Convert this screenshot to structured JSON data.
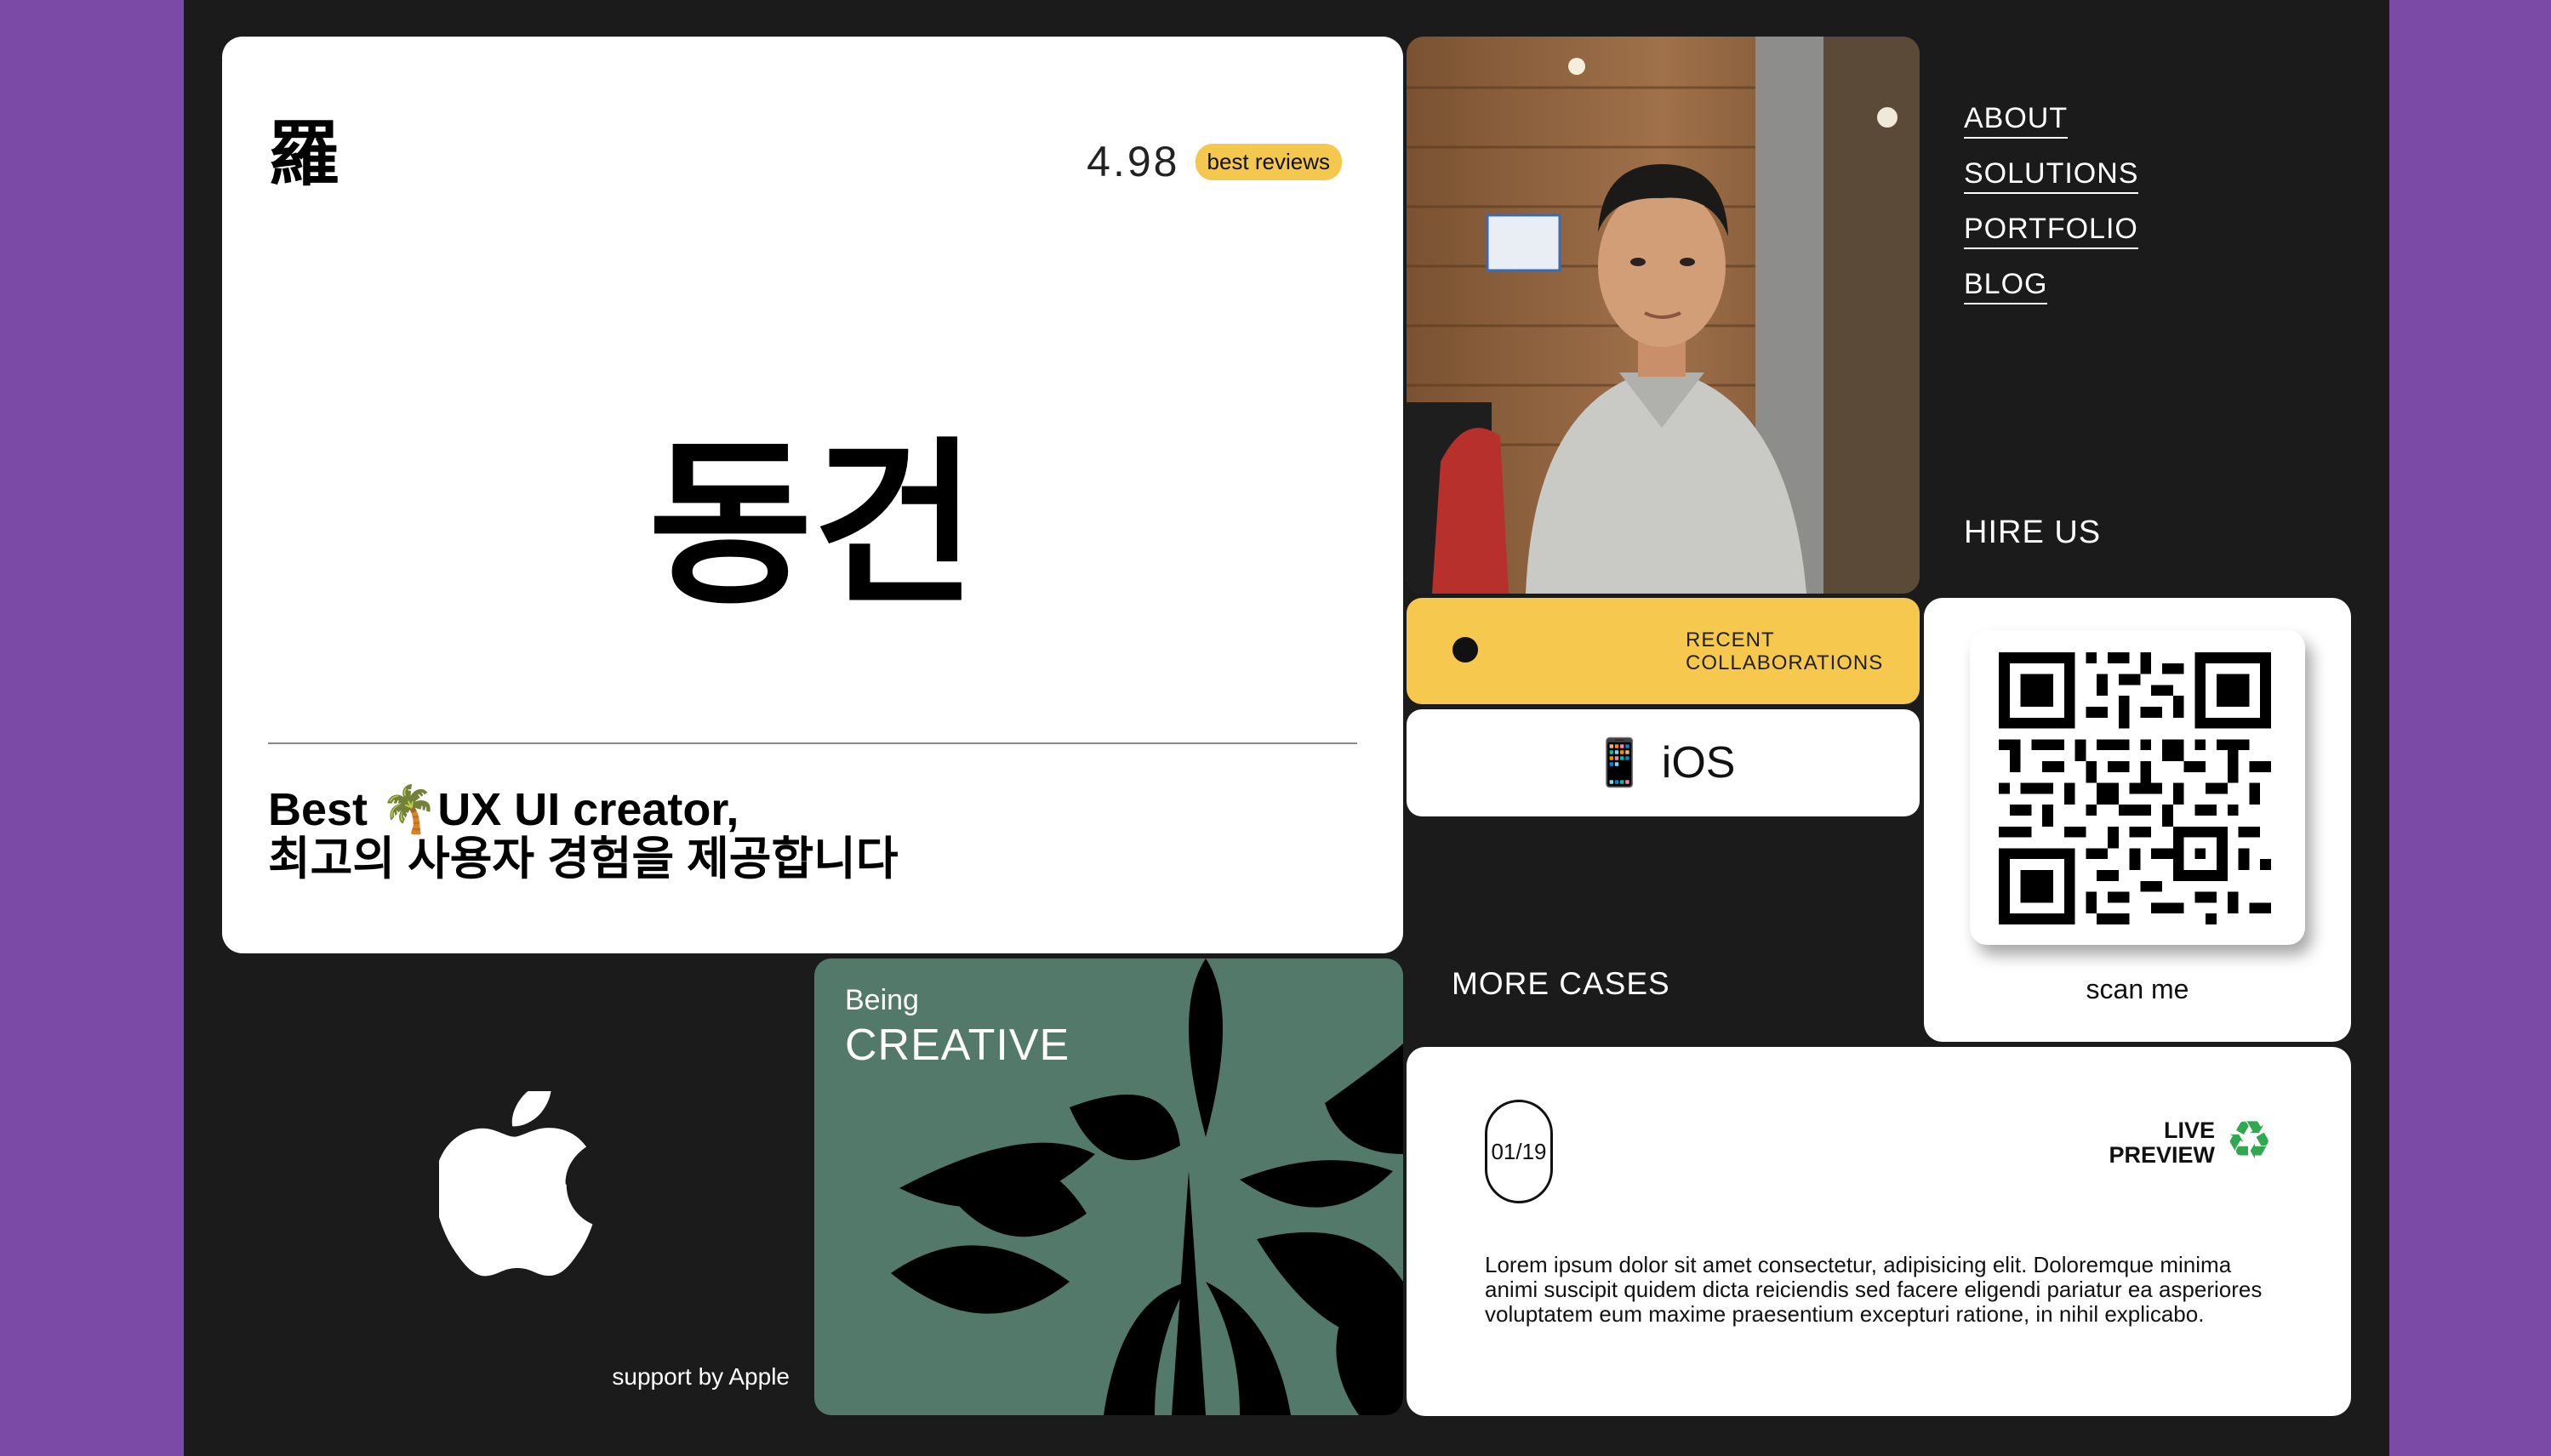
{
  "hero": {
    "logo_char": "羅",
    "rating": "4.98",
    "rating_badge": "best reviews",
    "name": "동건",
    "tagline_line1": "Best 🌴UX UI creator,",
    "tagline_line2": "최고의 사용자 경험을 제공합니다"
  },
  "nav": {
    "items": [
      {
        "label": "ABOUT"
      },
      {
        "label": "SOLUTIONS"
      },
      {
        "label": "PORTFOLIO"
      },
      {
        "label": "BLOG"
      }
    ],
    "hire": "HIRE US"
  },
  "collab": {
    "line1": "RECENT",
    "line2": "COLLABORATIONS"
  },
  "ios": {
    "icon": "mobile-phone-icon",
    "label": "iOS"
  },
  "qr": {
    "caption": "scan me"
  },
  "more_cases": "MORE CASES",
  "apple": {
    "caption": "support by Apple"
  },
  "creative": {
    "small": "Being",
    "big": "CREATIVE"
  },
  "case": {
    "counter": "01/19",
    "live_line1": "LIVE",
    "live_line2": "PREVIEW",
    "body": "Lorem ipsum dolor sit amet consectetur, adipisicing elit. Doloremque minima animi suscipit quidem dicta reiciendis sed facere eligendi pariatur ea asperiores voluptatem eum maxime praesentium excepturi ratione, in nihil explicabo."
  },
  "colors": {
    "background": "#7a4aa6",
    "frame": "#1b1b1b",
    "accent_yellow": "#f6c94e",
    "creative_green": "#52796a",
    "recycle_green": "#2fa84f"
  }
}
